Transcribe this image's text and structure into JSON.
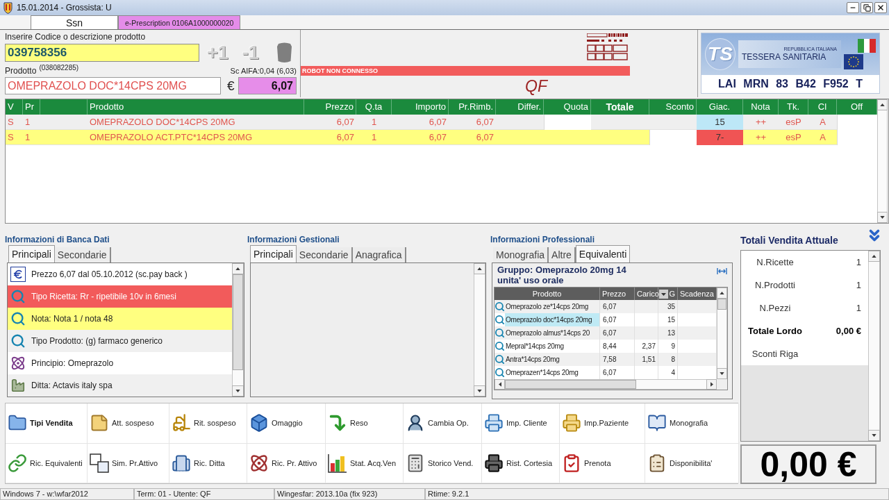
{
  "window": {
    "title": "15.01.2014 - Grossista: U"
  },
  "document_tabs": [
    {
      "label": "Ssn",
      "selected": true,
      "color": "#ffffff"
    },
    {
      "label": "e-Prescription 0106A1000000020",
      "selected": false,
      "color": "#e48ce9"
    }
  ],
  "code_entry": {
    "label": "Inserire Codice o descrizione prodotto",
    "value": "039758356",
    "buttons": [
      "+1",
      "-1"
    ]
  },
  "product": {
    "label": "Prodotto",
    "code": "(038082285)",
    "discount": "Sc AIFA:0,04 (6,03)",
    "name": "OMEPRAZOLO DOC*14CPS 20MG",
    "currency": "€",
    "price": "6,07"
  },
  "robot_status": "ROBOT NON CONNESSO",
  "operator": "QF",
  "health_card": {
    "logo": "TS",
    "issuer": "REPUBBLICA ITALIANA",
    "title": "TESSERA SANITARIA",
    "fiscal_code": "LAI MRN 83 B42 F952 T"
  },
  "sales_table": {
    "columns": [
      "V",
      "Pr",
      "Prodotto",
      "Prezzo",
      "Q.ta",
      "Importo",
      "Pr.Rimb.",
      "Differ.",
      "Quota",
      "Totale",
      "Sconto",
      "Giac.",
      "Nota",
      "Tk.",
      "Cl",
      "Off"
    ],
    "rows": [
      {
        "v": "S",
        "pr": "1",
        "product": "OMEPRAZOLO DOC*14CPS 20MG",
        "price": "6,07",
        "qty": "1",
        "amount": "6,07",
        "refund_price": "6,07",
        "stock": {
          "value": "15",
          "color": "#bde7f7"
        },
        "note": "++",
        "tk": "esP",
        "cl": "A",
        "selected": false,
        "quota_editing": true,
        "discount_editing": false
      },
      {
        "v": "S",
        "pr": "1",
        "product": "OMEPRAZOLO ACT.PTC*14CPS 20MG",
        "price": "6,07",
        "qty": "1",
        "amount": "6,07",
        "refund_price": "6,07",
        "stock": {
          "value": "7-",
          "color": "#f05454"
        },
        "note": "++",
        "tk": "esP",
        "cl": "A",
        "selected": true,
        "quota_editing": false,
        "discount_editing": true
      }
    ]
  },
  "bank_data": {
    "title": "Informazioni di Banca Dati",
    "tabs": [
      {
        "label": "Principali",
        "selected": true
      },
      {
        "label": "Secondarie",
        "selected": false
      }
    ],
    "items": [
      {
        "kind": "price",
        "text": "Prezzo 6,07 dal 05.10.2012 (sc.pay back )",
        "color": "#ffffff"
      },
      {
        "kind": "lookup",
        "text": "Tipo Ricetta: Rr - ripetibile 10v in 6mesi",
        "color": "#f25b5b"
      },
      {
        "kind": "lookup",
        "text": "Nota: Nota 1 / nota 48",
        "color": "#ffff80"
      },
      {
        "kind": "lookup",
        "text": "Tipo Prodotto: (g) farmaco generico",
        "color": "#f0f0f0"
      },
      {
        "kind": "substance",
        "text": "Principio: Omeprazolo",
        "color": "#ffffff"
      },
      {
        "kind": "company",
        "text": "Ditta: Actavis italy spa",
        "color": "#f0f0f0"
      }
    ]
  },
  "management": {
    "title": "Informazioni Gestionali",
    "tabs": [
      {
        "label": "Principali",
        "selected": true
      },
      {
        "label": "Secondarie",
        "selected": false
      },
      {
        "label": "Anagrafica",
        "selected": false
      }
    ]
  },
  "professional": {
    "title": "Informazioni Professionali",
    "tabs": [
      {
        "label": "Monografia",
        "selected": false
      },
      {
        "label": "Altre",
        "selected": false
      },
      {
        "label": "Equivalenti",
        "selected": true
      }
    ],
    "group": "Gruppo: Omeprazolo 20mg 14 unita' uso orale",
    "grid": {
      "columns": [
        "Prodotto",
        "Prezzo",
        "Carico",
        "G",
        "Scadenza"
      ],
      "rows": [
        {
          "product": "Omeprazolo ze*14cps 20mg",
          "price": "6,07",
          "stock": "35",
          "selected": false
        },
        {
          "product": "Omeprazolo doc*14cps 20mg",
          "price": "6,07",
          "stock": "15",
          "selected": true
        },
        {
          "product": "Omeprazolo almus*14cps 20",
          "price": "6,07",
          "stock": "13",
          "selected": false
        },
        {
          "product": "Mepral*14cps 20mg",
          "price": "8,44",
          "load": "2,37",
          "stock": "9",
          "selected": false
        },
        {
          "product": "Antra*14cps 20mg",
          "price": "7,58",
          "load": "1,51",
          "stock": "8",
          "selected": false
        },
        {
          "product": "Omeprazen*14cps 20mg",
          "price": "6,07",
          "stock": "4",
          "selected": false
        }
      ]
    }
  },
  "totals": {
    "title": "Totali Vendita Attuale",
    "rows": [
      {
        "label": "N.Ricette",
        "value": "1",
        "kind": "count"
      },
      {
        "label": "N.Prodotti",
        "value": "1",
        "kind": "count"
      },
      {
        "label": "N.Pezzi",
        "value": "1",
        "kind": "count"
      },
      {
        "label": "Totale Lordo",
        "value": "0,00 €",
        "kind": "total"
      },
      {
        "label": "Sconti Riga",
        "kind": "count"
      }
    ],
    "grand_total": "0,00 €"
  },
  "actions": [
    {
      "label": "Tipi Vendita",
      "kind": "folder",
      "default": true
    },
    {
      "label": "Att. sospeso",
      "kind": "note",
      "default": false
    },
    {
      "label": "Rit. sospeso",
      "kind": "forklift",
      "default": false
    },
    {
      "label": "Omaggio",
      "kind": "box",
      "default": false
    },
    {
      "label": "Reso",
      "kind": "return",
      "default": false
    },
    {
      "label": "Cambia Op.",
      "kind": "operator",
      "default": false
    },
    {
      "label": "Imp. Cliente",
      "kind": "print_client",
      "default": false
    },
    {
      "label": "Imp.Paziente",
      "kind": "print_patient",
      "default": false
    },
    {
      "label": "Monografia",
      "kind": "book",
      "default": false
    },
    {
      "label": "Ric. Equivalenti",
      "kind": "link",
      "default": false
    },
    {
      "label": "Sim. Pr.Attivo",
      "kind": "blocks",
      "default": false
    },
    {
      "label": "Ric. Ditta",
      "kind": "company",
      "default": false
    },
    {
      "label": "Ric. Pr. Attivo",
      "kind": "molecule",
      "default": false
    },
    {
      "label": "Stat. Acq.Ven",
      "kind": "chart",
      "default": false
    },
    {
      "label": "Storico Vend.",
      "kind": "register",
      "default": false
    },
    {
      "label": "Rist. Cortesia",
      "kind": "receipt_printer",
      "default": false
    },
    {
      "label": "Prenota",
      "kind": "checklist",
      "default": false
    },
    {
      "label": "Disponibilita'",
      "kind": "clipboard",
      "default": false
    }
  ],
  "status_bar": [
    "Windows 7 - w:\\wfar2012",
    "Term: 01 - Utente: QF",
    "Wingesfar: 2013.10a (fix 923)",
    "Rtime: 9.2.1"
  ]
}
